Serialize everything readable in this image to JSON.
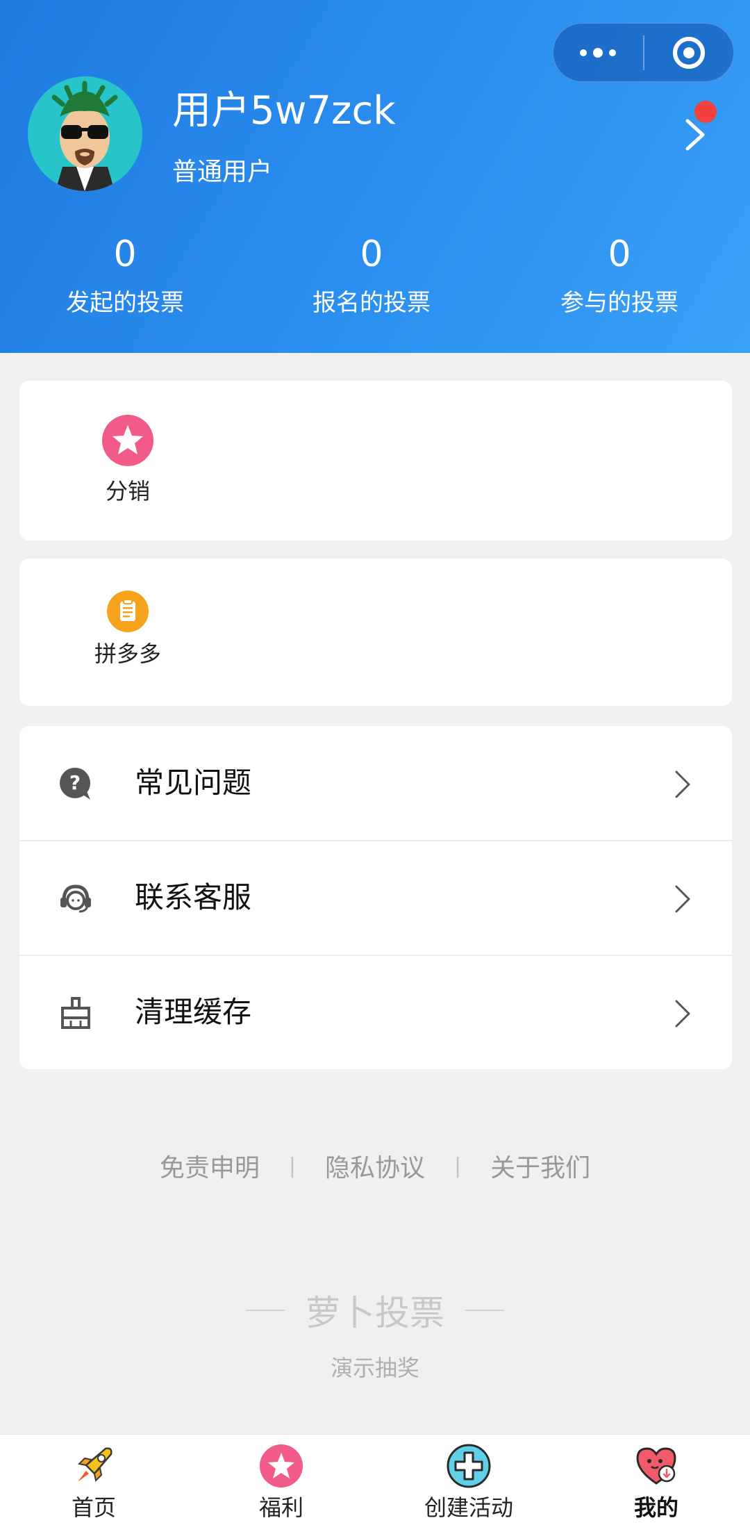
{
  "capsule": {
    "more_icon": "more-dots-icon",
    "close_icon": "target-circle-icon"
  },
  "profile": {
    "name": "用户5w7zck",
    "type": "普通用户",
    "has_notification": true
  },
  "stats": [
    {
      "value": "0",
      "label": "发起的投票"
    },
    {
      "value": "0",
      "label": "报名的投票"
    },
    {
      "value": "0",
      "label": "参与的投票"
    }
  ],
  "card1": {
    "label": "分销",
    "icon": "pink-star-icon"
  },
  "card2": {
    "label": "拼多多",
    "icon": "orange-clipboard-icon"
  },
  "menu": [
    {
      "label": "常见问题",
      "icon": "question-bubble-icon"
    },
    {
      "label": "联系客服",
      "icon": "headset-icon"
    },
    {
      "label": "清理缓存",
      "icon": "broom-icon"
    }
  ],
  "footer_links": [
    "免责申明",
    "隐私协议",
    "关于我们"
  ],
  "footer_sep": "|",
  "brand": {
    "name": "萝卜投票",
    "subtitle": "演示抽奖"
  },
  "tabbar": [
    {
      "label": "首页",
      "icon": "rocket-icon",
      "active": false
    },
    {
      "label": "福利",
      "icon": "pink-star-icon",
      "active": false
    },
    {
      "label": "创建活动",
      "icon": "plus-circle-icon",
      "active": false
    },
    {
      "label": "我的",
      "icon": "heart-face-icon",
      "active": true
    }
  ],
  "colors": {
    "header_blue": "#2b8ff0",
    "badge_red": "#f04141",
    "star_pink": "#f25a8a",
    "clip_orange": "#f7a21b"
  }
}
